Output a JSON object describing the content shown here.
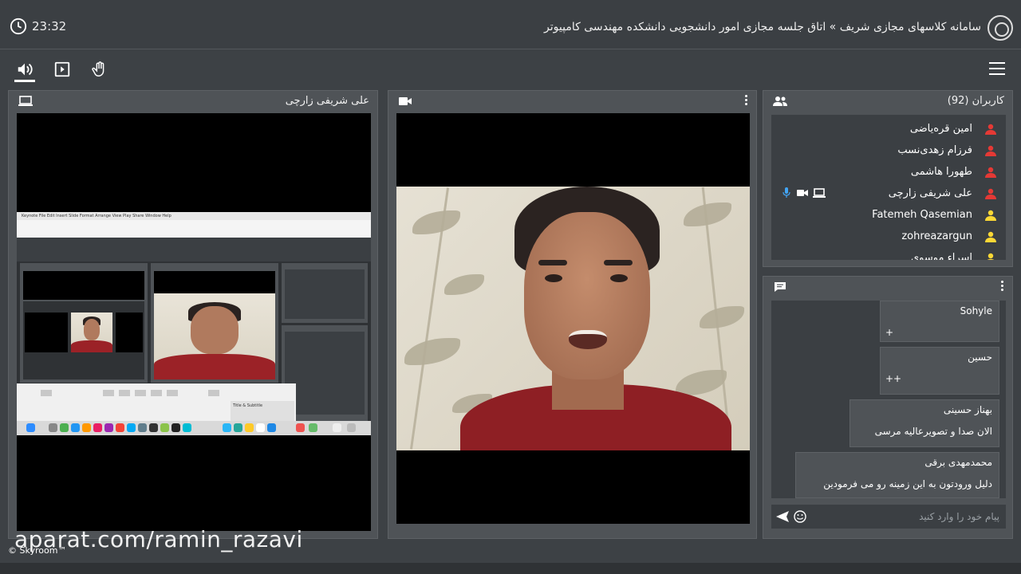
{
  "header": {
    "time": "23:32",
    "title": "سامانه کلاسهای مجازی شریف » اتاق جلسه مجازی امور دانشجویی دانشکده مهندسی کامپیوتر"
  },
  "toolbar": {
    "icons": [
      "speaker-icon",
      "screen-share-icon",
      "raise-hand-icon",
      "menu-icon"
    ]
  },
  "screen_panel": {
    "title": "علی شریفی زارچی",
    "keynote_menu": "Keynote   File   Edit   Insert   Slide   Format   Arrange   View   Play   Share   Window   Help",
    "keynote_doc": "Title & Subtitle"
  },
  "video_panel": {
    "title": ""
  },
  "users_panel": {
    "title": "کاربران (92)",
    "users": [
      {
        "name": "امین قره‌یاضی",
        "role": "presenter",
        "color": "#e53935"
      },
      {
        "name": "فرزام زهدی‌نسب",
        "role": "presenter",
        "color": "#e53935"
      },
      {
        "name": "طهورا هاشمی",
        "role": "presenter",
        "color": "#e53935"
      },
      {
        "name": "علی شریفی زارچی",
        "role": "presenter",
        "color": "#e53935",
        "mic": true,
        "camera": true,
        "screen": true
      },
      {
        "name": "Fatemeh Qasemian",
        "role": "listener",
        "color": "#fdd835"
      },
      {
        "name": "zohreazargun",
        "role": "listener",
        "color": "#fdd835"
      },
      {
        "name": "اسراء موسوی",
        "role": "listener",
        "color": "#fdd835"
      }
    ]
  },
  "chat_panel": {
    "messages": [
      {
        "sender": "Sohyle",
        "text": "+"
      },
      {
        "sender": "حسین",
        "text": "++"
      },
      {
        "sender": "بهناز حسینی",
        "text": "الان صدا و تصویرعالیه مرسی"
      },
      {
        "sender": "محمدمهدی برقی",
        "text": "دلیل ورودتون به این زمینه رو می فرمودین"
      }
    ],
    "input_placeholder": "پیام خود را وارد کنید"
  },
  "overlay": {
    "watermark": "aparat.com/ramin_razavi",
    "brand": "© Skyroom™"
  },
  "colors": {
    "background": "#3d4145",
    "panel": "#4f5357",
    "presenter": "#e53935",
    "listener": "#fdd835",
    "mic_active": "#42a5f5"
  }
}
